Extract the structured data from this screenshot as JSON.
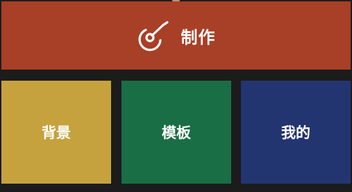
{
  "colors": {
    "background": "#1c1c1c",
    "make": "#a83f27",
    "background_tile": "#c5a23e",
    "template_tile": "#196e45",
    "mine_tile": "#233570"
  },
  "make": {
    "icon": "guitar-icon",
    "label": "制作"
  },
  "tiles": [
    {
      "label": "背景"
    },
    {
      "label": "模板"
    },
    {
      "label": "我的"
    }
  ]
}
